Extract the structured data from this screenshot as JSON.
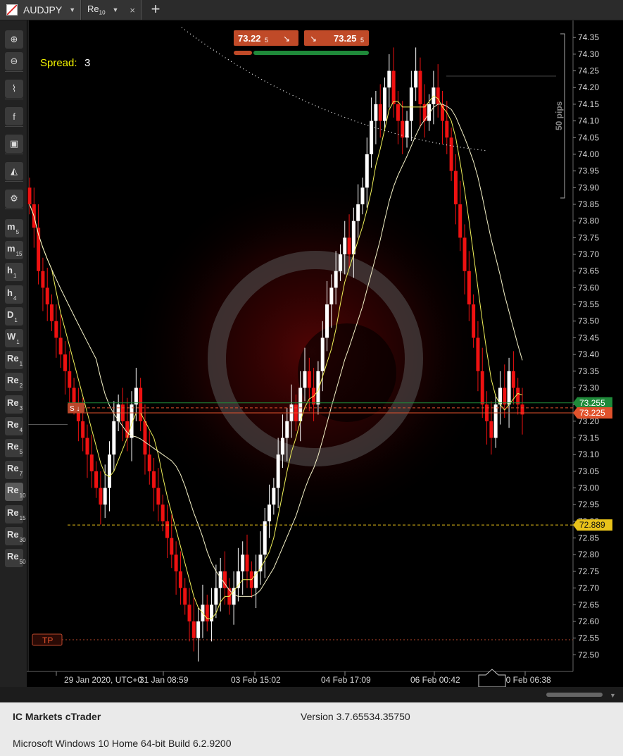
{
  "tabs": [
    {
      "symbol": "AUDJPY",
      "has_dropdown": true
    },
    {
      "timeframe": "Re",
      "timeframe_sub": "10",
      "has_dropdown": true
    }
  ],
  "icons": {
    "close": "×",
    "add_tab": "+",
    "caret": "▼"
  },
  "toolbar": {
    "tools": [
      "zoom-in-icon",
      "zoom-out-icon",
      "chart-type-icon",
      "facebook-icon",
      "cbot-icon",
      "objects-icon",
      "chart-settings-icon"
    ],
    "timeframes": [
      {
        "main": "m",
        "sub": "5"
      },
      {
        "main": "m",
        "sub": "15"
      },
      {
        "main": "h",
        "sub": "1"
      },
      {
        "main": "h",
        "sub": "4"
      },
      {
        "main": "D",
        "sub": "1"
      },
      {
        "main": "W",
        "sub": "1"
      },
      {
        "main": "Re",
        "sub": "1"
      },
      {
        "main": "Re",
        "sub": "2"
      },
      {
        "main": "Re",
        "sub": "3"
      },
      {
        "main": "Re",
        "sub": "4"
      },
      {
        "main": "Re",
        "sub": "5"
      },
      {
        "main": "Re",
        "sub": "7"
      },
      {
        "main": "Re",
        "sub": "10"
      },
      {
        "main": "Re",
        "sub": "15"
      },
      {
        "main": "Re",
        "sub": "30"
      },
      {
        "main": "Re",
        "sub": "50"
      }
    ],
    "active_timeframe": "Re10"
  },
  "chart_data": {
    "type": "candlestick",
    "symbol": "AUDJPY",
    "spread_label": "Spread:",
    "spread_value": "3",
    "sell_price": {
      "main": "73.22",
      "pip": "5"
    },
    "buy_price": {
      "main": "73.25",
      "pip": "5"
    },
    "range_label": "50 pips",
    "ylim": [
      72.45,
      74.38
    ],
    "y_ticks": [
      "74.35",
      "74.30",
      "74.25",
      "74.20",
      "74.15",
      "74.10",
      "74.05",
      "74.00",
      "73.95",
      "73.90",
      "73.85",
      "73.80",
      "73.75",
      "73.70",
      "73.65",
      "73.60",
      "73.55",
      "73.50",
      "73.45",
      "73.40",
      "73.35",
      "73.30",
      "73.25",
      "73.20",
      "73.15",
      "73.10",
      "73.05",
      "73.00",
      "72.95",
      "72.90",
      "72.85",
      "72.80",
      "72.75",
      "72.70",
      "72.65",
      "72.60",
      "72.55",
      "72.50"
    ],
    "x_labels": [
      "29 Jan 2020, UTC+0",
      "31 Jan 08:59",
      "03 Feb 15:02",
      "04 Feb 17:09",
      "06 Feb 00:42",
      "10 Feb 06:38"
    ],
    "price_levels": [
      {
        "label": "73.255",
        "value": 73.255,
        "color": "#1f8a3a"
      },
      {
        "label": "73.225",
        "value": 73.225,
        "color": "#e0522c"
      },
      {
        "label": "72.889",
        "value": 72.889,
        "color": "#e8c21a"
      }
    ],
    "tp_label": "TP",
    "tp_value": 72.545,
    "sl_label": "S",
    "closes": [
      73.85,
      73.78,
      73.65,
      73.6,
      73.55,
      73.5,
      73.45,
      73.4,
      73.35,
      73.3,
      73.25,
      73.2,
      73.15,
      73.1,
      73.05,
      73.0,
      72.95,
      73.0,
      73.1,
      73.2,
      73.25,
      73.2,
      73.15,
      73.25,
      73.3,
      73.2,
      73.1,
      73.05,
      73.0,
      72.95,
      72.9,
      72.85,
      72.8,
      72.75,
      72.7,
      72.65,
      72.6,
      72.55,
      72.6,
      72.65,
      72.6,
      72.65,
      72.7,
      72.75,
      72.7,
      72.65,
      72.7,
      72.75,
      72.8,
      72.75,
      72.7,
      72.75,
      72.8,
      72.9,
      72.95,
      73.0,
      73.1,
      73.15,
      73.2,
      73.25,
      73.2,
      73.3,
      73.35,
      73.3,
      73.25,
      73.35,
      73.45,
      73.55,
      73.6,
      73.65,
      73.7,
      73.75,
      73.7,
      73.8,
      73.85,
      73.9,
      74.0,
      74.1,
      74.15,
      74.1,
      74.2,
      74.25,
      74.15,
      74.1,
      74.05,
      74.1,
      74.2,
      74.25,
      74.15,
      74.1,
      74.15,
      74.2,
      74.15,
      74.1,
      74.05,
      73.95,
      73.85,
      73.75,
      73.65,
      73.55,
      73.45,
      73.35,
      73.25,
      73.2,
      73.15,
      73.25,
      73.3,
      73.25,
      73.35,
      73.3,
      73.25,
      73.22
    ]
  },
  "footer": {
    "app_name": "IC Markets cTrader",
    "version": "Version 3.7.65534.35750",
    "os_info": "Microsoft Windows 10 Home 64-bit Build 6.2.9200"
  }
}
